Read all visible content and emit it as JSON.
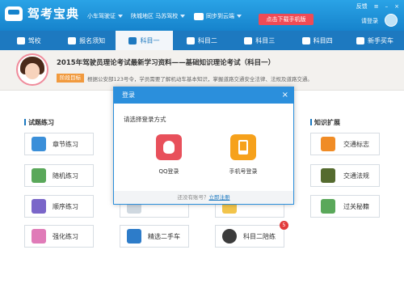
{
  "app": {
    "title": "驾考宝典",
    "car_type": "小车驾驶证",
    "region": "陕城地区 马苏驾校",
    "sync": "同步到云端",
    "download_button": "点击下载手机版",
    "feedback": "反馈",
    "login_link": "请登录"
  },
  "nav": [
    {
      "label": "驾校",
      "icon": "house-icon"
    },
    {
      "label": "报名须知",
      "icon": "document-icon"
    },
    {
      "label": "科目一",
      "icon": "pencil-icon",
      "active": true
    },
    {
      "label": "科目二",
      "icon": "cone-icon"
    },
    {
      "label": "科目三",
      "icon": "car-icon"
    },
    {
      "label": "科目四",
      "icon": "book-icon"
    },
    {
      "label": "新手买车",
      "icon": "new-car-icon"
    }
  ],
  "banner": {
    "title": "2015年驾驶员理论考试最新学习资料——基础知识理论考试（科目一）",
    "tag": "阶段目标",
    "description": "根据公安部123号令，学员需要了解机动车基本知识，掌握道路交通安全法律、法规及道路交通。"
  },
  "sections": {
    "left_title": "试题练习",
    "right_title": "知识扩展"
  },
  "left_tiles": [
    {
      "label": "章节练习",
      "icon": "chapter-icon",
      "color": "#3b8fd9"
    },
    {
      "label": "随机练习",
      "icon": "random-icon",
      "color": "#5aa85a"
    },
    {
      "label": "顺序练习",
      "icon": "sequence-icon",
      "color": "#7a66c9"
    },
    {
      "label": "强化练习",
      "icon": "reinforce-icon",
      "color": "#e07bb8"
    }
  ],
  "middle_tiles": [
    {
      "label": "精选二手车",
      "icon": "truck-icon",
      "color": "#2d7cc9"
    }
  ],
  "right_bottom_tile": {
    "label": "科目二陪练",
    "icon": "driver-icon",
    "color": "#3c3c3c",
    "badge": "5"
  },
  "right_tiles": [
    {
      "label": "交通标志",
      "icon": "traffic-cone-icon",
      "color": "#f08c26"
    },
    {
      "label": "交通法规",
      "icon": "police-icon",
      "color": "#556b2f"
    },
    {
      "label": "过关秘籍",
      "icon": "checklist-icon",
      "color": "#5aa85a"
    }
  ],
  "modal": {
    "title": "登录",
    "close": "×",
    "subtitle": "请选择登录方式",
    "qq_label": "QQ登录",
    "phone_label": "手机号登录",
    "footer_text": "还没有账号？",
    "register_link": "立即注册",
    "qq_color": "#e8505b",
    "phone_color": "#f6a11b"
  }
}
